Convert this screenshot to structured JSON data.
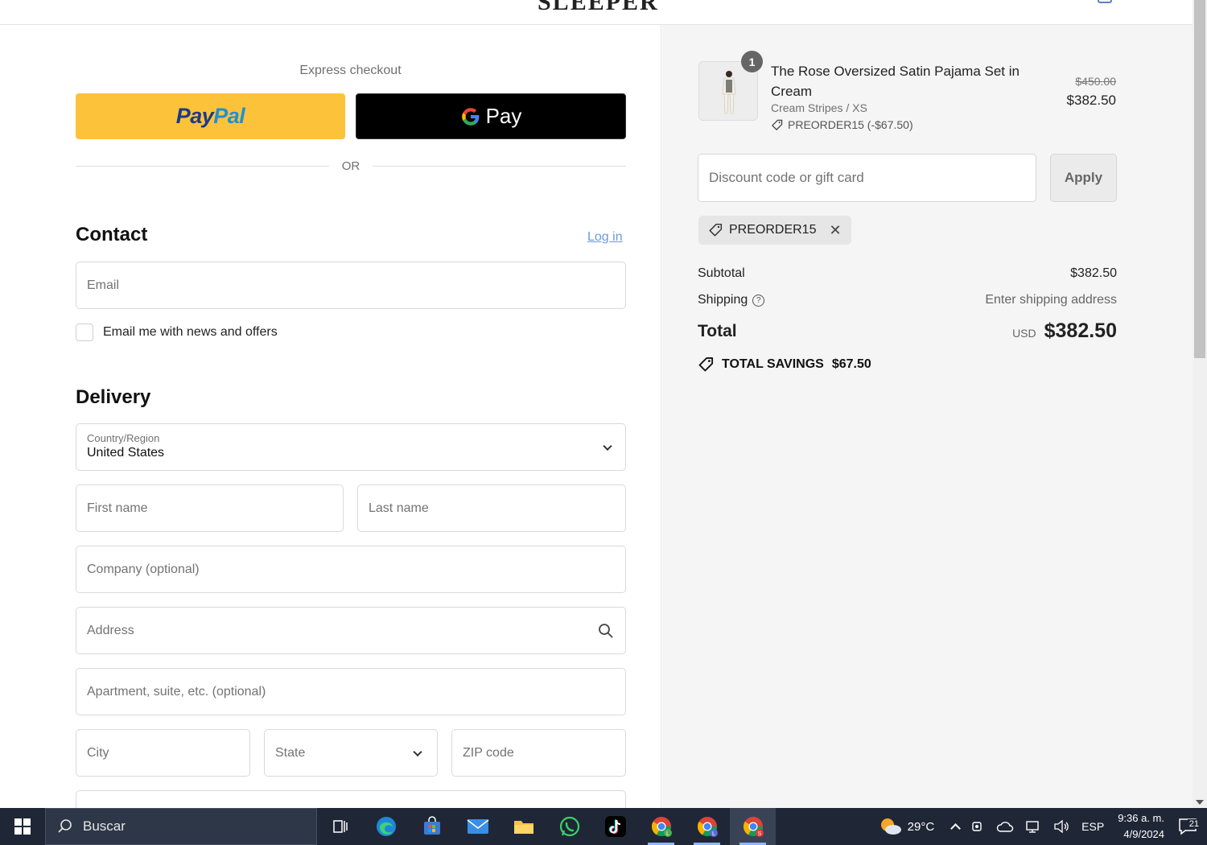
{
  "header": {
    "logo": "SLEEPER"
  },
  "express": {
    "title": "Express checkout",
    "paypal_a": "Pay",
    "paypal_b": "Pal",
    "gpay_label": "Pay",
    "or": "OR"
  },
  "contact": {
    "title": "Contact",
    "login": "Log in",
    "email_placeholder": "Email",
    "news_label": "Email me with news and offers"
  },
  "delivery": {
    "title": "Delivery",
    "country_label": "Country/Region",
    "country_value": "United States",
    "first_name": "First name",
    "last_name": "Last name",
    "company": "Company (optional)",
    "address": "Address",
    "apartment": "Apartment, suite, etc. (optional)",
    "city": "City",
    "state": "State",
    "zip": "ZIP code"
  },
  "order": {
    "qty": "1",
    "product_name": "The Rose Oversized Satin Pajama Set in Cream",
    "variant": "Cream Stripes / XS",
    "discount_line": "PREORDER15 (-$67.50)",
    "price_original": "$450.00",
    "price_now": "$382.50",
    "discount_placeholder": "Discount code or gift card",
    "apply": "Apply",
    "applied_code": "PREORDER15",
    "subtotal_label": "Subtotal",
    "subtotal_value": "$382.50",
    "shipping_label": "Shipping",
    "shipping_value": "Enter shipping address",
    "total_label": "Total",
    "total_currency": "USD",
    "total_value": "$382.50",
    "savings_label": "TOTAL SAVINGS",
    "savings_value": "$67.50"
  },
  "taskbar": {
    "search": "Buscar",
    "temperature": "29°C",
    "language": "ESP",
    "time": "9:36 a. m.",
    "date": "4/9/2024",
    "notifications": "21",
    "chrome_badges": [
      "L",
      "L",
      "S"
    ]
  },
  "colors": {
    "paypal_bg": "#fcc33a",
    "gpay_bg": "#000000",
    "link": "#6a9bd8",
    "summary_bg": "#f5f5f5",
    "taskbar_bg": "#1f2736"
  }
}
